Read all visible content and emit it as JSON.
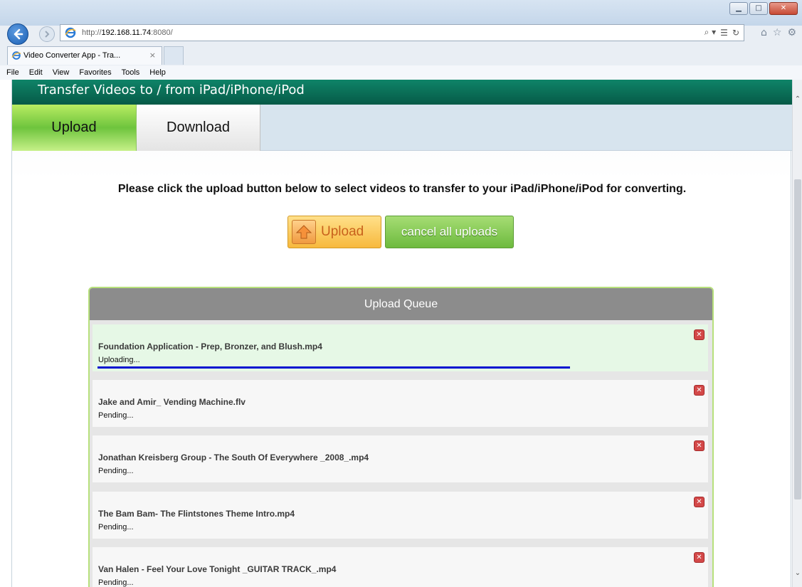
{
  "browser": {
    "url_prefix": "http://",
    "url_host": "192.168.11.74",
    "url_suffix": ":8080/",
    "tab_title": "Video Converter App - Tra...",
    "tab_close": "×",
    "menu": [
      "File",
      "Edit",
      "View",
      "Favorites",
      "Tools",
      "Help"
    ],
    "address_tools": [
      "⌕ ▾",
      "☰",
      "↻"
    ],
    "toolbar_icons": [
      "home-icon",
      "star-icon",
      "gear-icon"
    ]
  },
  "app": {
    "title": "Transfer Videos to / from iPad/iPhone/iPod",
    "tabs": [
      {
        "label": "Upload",
        "active": true
      },
      {
        "label": "Download",
        "active": false
      }
    ],
    "instruction": "Please click the upload button below to select videos to transfer to your iPad/iPhone/iPod for converting.",
    "upload_button": "Upload",
    "cancel_button": "cancel all uploads"
  },
  "queue": {
    "title": "Upload Queue",
    "items": [
      {
        "name": "Foundation Application - Prep, Bronzer, and Blush.mp4",
        "status": "Uploading...",
        "progress": 0.78
      },
      {
        "name": "Jake and Amir_ Vending Machine.flv",
        "status": "Pending..."
      },
      {
        "name": "Jonathan Kreisberg Group - The South Of Everywhere _2008_.mp4",
        "status": "Pending..."
      },
      {
        "name": "The Bam Bam- The Flintstones Theme Intro.mp4",
        "status": "Pending..."
      },
      {
        "name": "Van Halen - Feel Your Love Tonight _GUITAR TRACK_.mp4",
        "status": "Pending..."
      }
    ]
  },
  "colors": {
    "header_green": "#0a6e56",
    "active_tab": "#8cd44a",
    "upload_button": "#f7b93d",
    "cancel_button": "#6dba3e",
    "progress_bar": "#0010d0"
  }
}
